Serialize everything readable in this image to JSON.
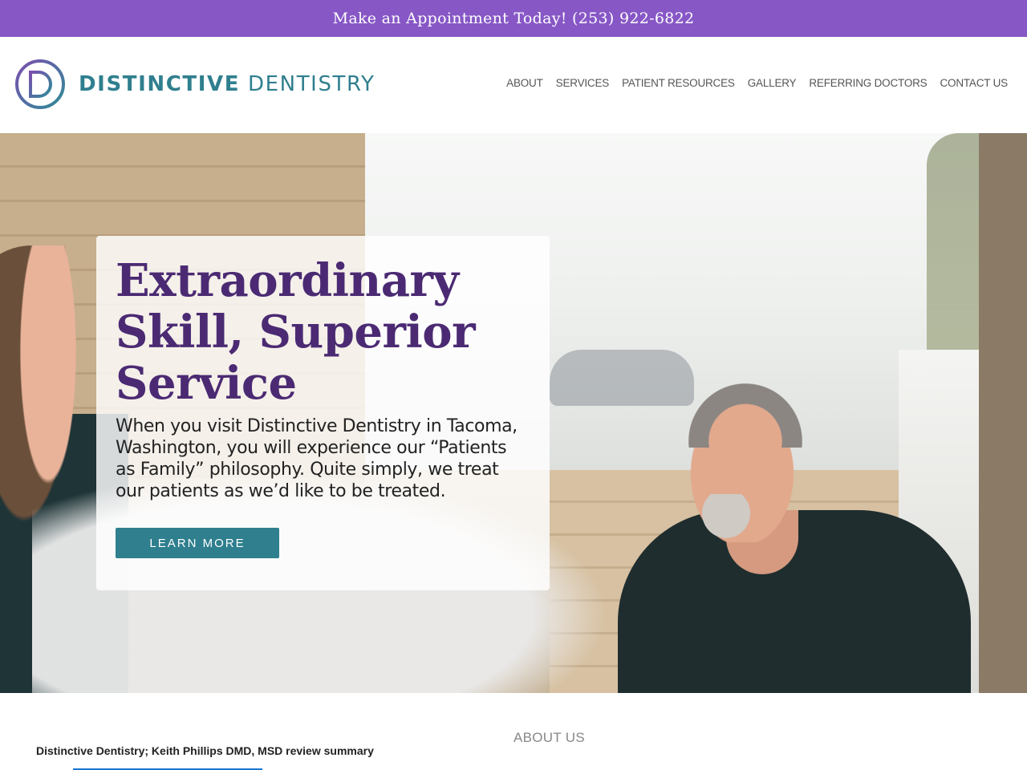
{
  "topbar": {
    "text": "Make an Appointment Today! (253) 922-6822"
  },
  "header": {
    "logo_bold": "DISTINCTIVE",
    "logo_light": "DENTISTRY",
    "logo_icon": "tooth-d-logo-icon",
    "nav": [
      {
        "label": "ABOUT"
      },
      {
        "label": "SERVICES"
      },
      {
        "label": "PATIENT RESOURCES"
      },
      {
        "label": "GALLERY"
      },
      {
        "label": "REFERRING DOCTORS"
      },
      {
        "label": "CONTACT US"
      }
    ]
  },
  "hero": {
    "title_line1": "Extraordinary",
    "title_line2": "Skill, Superior",
    "title_line3": "Service",
    "text": "When you visit Distinctive Dentistry in Tacoma, Washington, you will experience our “Patients as Family” philosophy. Quite simply, we treat our patients as we’d like to be treated.",
    "button_label": "LEARN MORE"
  },
  "review": {
    "title": "Distinctive Dentistry; Keith Phillips DMD, MSD review summary"
  },
  "about": {
    "heading": "ABOUT US"
  },
  "colors": {
    "topbar": "#8757c6",
    "brand_teal": "#2f7f8e",
    "title_purple": "#4b2a73"
  }
}
